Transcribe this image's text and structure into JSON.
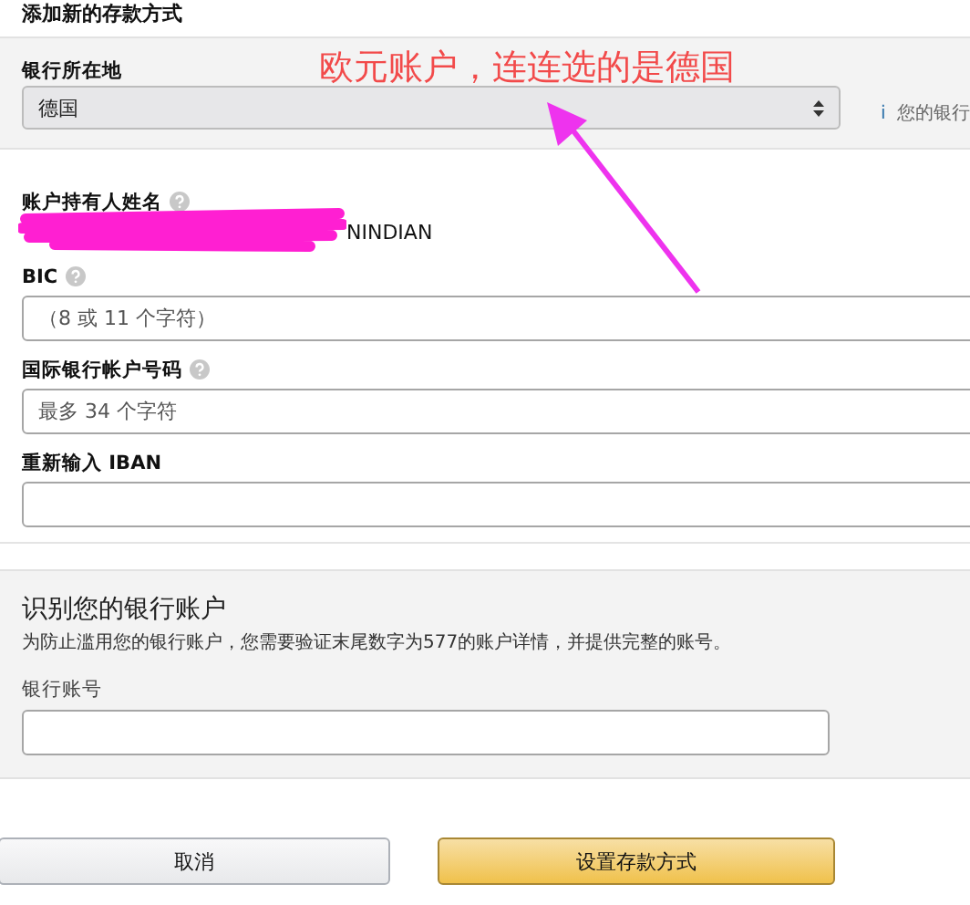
{
  "page_title": "添加新的存款方式",
  "bank_location": {
    "label": "银行所在地",
    "value": "德国",
    "info_icon": "i",
    "info": "您的银行"
  },
  "annotation": {
    "text": "欧元账户，连连选的是德国"
  },
  "fields": [
    {
      "label": "账户持有人姓名",
      "help": true,
      "kind": "text",
      "value": "NINDIAN",
      "redacted": true
    },
    {
      "label": "BIC",
      "help": true,
      "kind": "input",
      "placeholder": "（8 或 11 个字符）"
    },
    {
      "label": "国际银行帐户号码",
      "help": true,
      "kind": "input",
      "placeholder": "最多 34 个字符"
    },
    {
      "label": "重新输入 IBAN",
      "help": false,
      "kind": "input"
    }
  ],
  "verify": {
    "title": "识别您的银行账户",
    "description": "为防止滥用您的银行账户，您需要验证末尾数字为577的账户详情，并提供完整的账号。",
    "field_label": "银行账号"
  },
  "buttons": [
    {
      "label": "取消",
      "kind": "secondary"
    },
    {
      "label": "设置存款方式",
      "kind": "primary"
    }
  ]
}
